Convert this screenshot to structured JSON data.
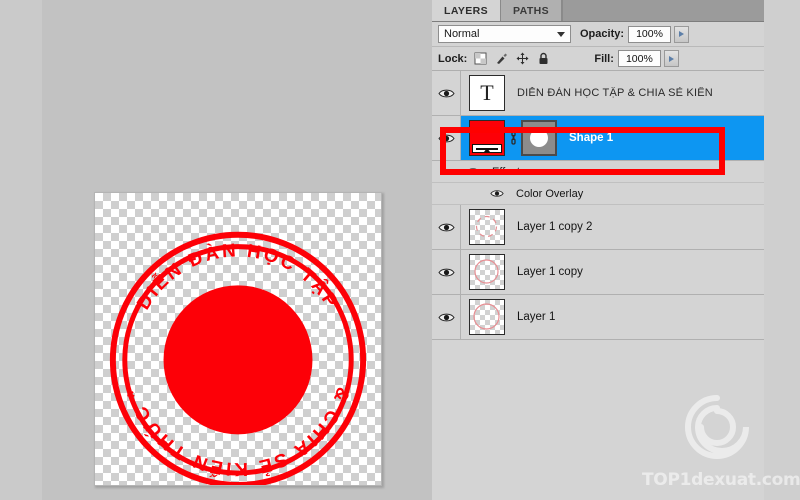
{
  "app": {
    "name": "Adobe Photoshop Layers Panel"
  },
  "panel": {
    "tabs": [
      {
        "label": "LAYERS",
        "active": true
      },
      {
        "label": "PATHS",
        "active": false
      }
    ],
    "blend": {
      "mode_value": "Normal",
      "opacity_label": "Opacity:",
      "opacity_value": "100%"
    },
    "lock": {
      "label": "Lock:",
      "icons": [
        "lock-transparent-pixels-icon",
        "lock-image-pixels-icon",
        "lock-position-icon",
        "lock-all-icon"
      ],
      "fill_label": "Fill:",
      "fill_value": "100%"
    },
    "layers": [
      {
        "name": "DIỄN ĐÀN HỌC TẬP & CHIA SẺ KIẾN",
        "kind": "text",
        "thumb_glyph": "T",
        "visible": true,
        "selected": false
      },
      {
        "name": "Shape 1",
        "kind": "shape",
        "visible": true,
        "selected": true,
        "color": "#fd0007",
        "has_mask": true,
        "effects": {
          "group_label": "Effects",
          "items": [
            {
              "label": "Color Overlay",
              "visible": true
            }
          ]
        }
      },
      {
        "name": "Layer 1 copy 2",
        "kind": "raster",
        "visible": true,
        "selected": false
      },
      {
        "name": "Layer 1 copy",
        "kind": "raster",
        "visible": true,
        "selected": false
      },
      {
        "name": "Layer 1",
        "kind": "raster",
        "visible": true,
        "selected": false
      }
    ]
  },
  "canvas": {
    "stamp": {
      "ring_color": "#fd0007",
      "fill_color": "#fd0007",
      "circular_text": "DIỄN ĐÀN HỌC TẬP & CHIA SẺ KIẾN THỨC *",
      "arc_segments": [
        "DIỄN",
        "ĐÀN",
        "HỌC",
        "TẬP",
        "&",
        "CHIA",
        "SẺ",
        "KIẾN",
        "THỨC",
        "*"
      ],
      "transparency_checkerboard": true
    }
  },
  "annotation": {
    "highlight_color": "#ff0000",
    "target": "Shape 1 layer row"
  },
  "watermark": {
    "text": "TOP1dexuat.com",
    "mark": "spiral-swirl-icon",
    "color": "#ffffff"
  }
}
